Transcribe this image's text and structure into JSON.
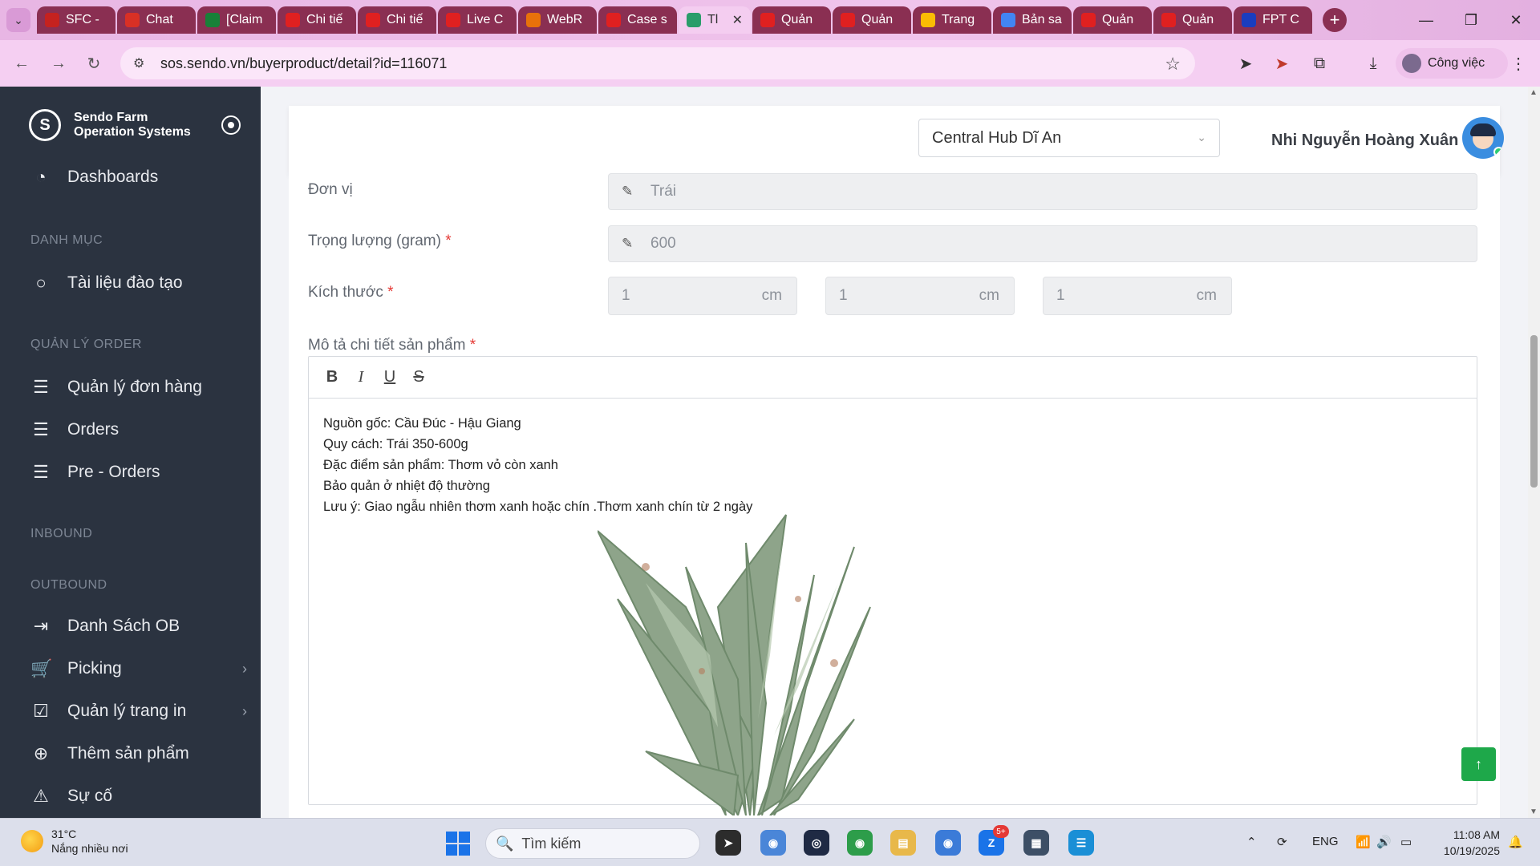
{
  "browser": {
    "tabs": [
      {
        "label": "SFC -",
        "icon": "gmail-icon",
        "color": "#c5221f"
      },
      {
        "label": "Chat",
        "icon": "chat-icon",
        "color": "#d93025"
      },
      {
        "label": "[Claim",
        "icon": "sheets-icon",
        "color": "#188038"
      },
      {
        "label": "Chi tiế",
        "icon": "sendo-icon",
        "color": "#e02020"
      },
      {
        "label": "Chi tiế",
        "icon": "sendo-icon",
        "color": "#e02020"
      },
      {
        "label": "Live C",
        "icon": "sendo-icon",
        "color": "#e02020"
      },
      {
        "label": "WebR",
        "icon": "camera-icon",
        "color": "#e8710a"
      },
      {
        "label": "Case s",
        "icon": "sendo-icon",
        "color": "#e02020"
      },
      {
        "label": "Tl",
        "icon": "sendo-icon",
        "color": "#2a9d6a",
        "active": true
      },
      {
        "label": "Quản",
        "icon": "sendo-icon",
        "color": "#e02020"
      },
      {
        "label": "Quản",
        "icon": "sendo-icon",
        "color": "#e02020"
      },
      {
        "label": "Trang",
        "icon": "drive-icon",
        "color": "#fbbc04"
      },
      {
        "label": "Bản sa",
        "icon": "docs-icon",
        "color": "#4285f4"
      },
      {
        "label": "Quản",
        "icon": "sendo-icon",
        "color": "#e02020"
      },
      {
        "label": "Quản",
        "icon": "sendo-icon",
        "color": "#e02020"
      },
      {
        "label": "FPT C",
        "icon": "fpt-icon",
        "color": "#1a3dbf"
      }
    ],
    "url": "sos.sendo.vn/buyerproduct/detail?id=116071",
    "profile_label": "Công việc"
  },
  "sidebar": {
    "brand_line1": "Sendo Farm",
    "brand_line2": "Operation Systems",
    "dashboards": "Dashboards",
    "section_danh_muc": "DANH MỤC",
    "tai_lieu": "Tài liệu đào tạo",
    "section_order": "QUẢN LÝ ORDER",
    "quan_ly_don_hang": "Quản lý đơn hàng",
    "orders": "Orders",
    "pre_orders": "Pre - Orders",
    "section_inbound": "INBOUND",
    "section_outbound": "OUTBOUND",
    "danh_sach_ob": "Danh Sách OB",
    "picking": "Picking",
    "quan_ly_trang_in": "Quản lý trang in",
    "them_san_pham": "Thêm sản phẩm",
    "su_co": "Sự cố"
  },
  "header": {
    "hub": "Central Hub Dĩ An",
    "user_name": "Nhi Nguyễn Hoàng Xuân"
  },
  "form": {
    "unit_label": "Đơn vị",
    "unit_value": "Trái",
    "weight_label": "Trọng lượng (gram)",
    "weight_value": "600",
    "size_label": "Kích thước",
    "size_unit": "cm",
    "size_values": [
      "1",
      "1",
      "1"
    ],
    "required_mark": "*",
    "desc_label": "Mô tả chi tiết sản phẩm",
    "desc_lines": [
      "Nguồn gốc: Cầu Đúc - Hậu Giang",
      "Quy cách: Trái 350-600g",
      "Đặc điểm sản phẩm: Thơm vỏ còn xanh",
      "Bảo quản ở nhiệt độ thường",
      "Lưu ý: Giao ngẫu nhiên thơm xanh hoặc chín .Thơm xanh chín từ 2 ngày"
    ]
  },
  "taskbar": {
    "temperature": "31°C",
    "weather": "Nắng nhiều nơi",
    "search_placeholder": "Tìm kiếm",
    "lang": "ENG",
    "time": "11:08 AM",
    "date": "10/19/2025",
    "zalo_badge": "5+"
  },
  "colors": {
    "sidebar_bg": "#2b3340",
    "accent_green": "#1ea84a",
    "required_red": "#e53935"
  }
}
